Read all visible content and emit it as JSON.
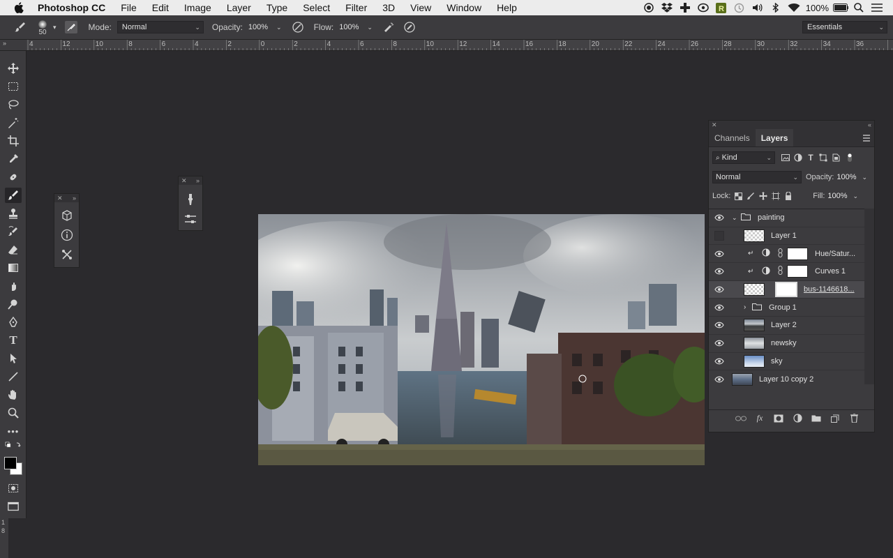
{
  "menubar": {
    "app_name": "Photoshop CC",
    "items": [
      "File",
      "Edit",
      "Image",
      "Layer",
      "Type",
      "Select",
      "Filter",
      "3D",
      "View",
      "Window",
      "Help"
    ],
    "battery": "100%"
  },
  "options": {
    "brush_size": "50",
    "mode_label": "Mode:",
    "mode_value": "Normal",
    "opacity_label": "Opacity:",
    "opacity_value": "100%",
    "flow_label": "Flow:",
    "flow_value": "100%",
    "workspace": "Essentials"
  },
  "ruler": {
    "labels": [
      "4",
      "12",
      "10",
      "8",
      "6",
      "4",
      "2",
      "0",
      "2",
      "4",
      "6",
      "8",
      "10",
      "12",
      "14",
      "16",
      "18",
      "20",
      "22",
      "24",
      "26",
      "28",
      "30",
      "32",
      "34",
      "36"
    ]
  },
  "layers_panel": {
    "tabs": [
      "Channels",
      "Layers"
    ],
    "filter_kind": "Kind",
    "blend_mode": "Normal",
    "opacity_label": "Opacity:",
    "opacity_value": "100%",
    "lock_label": "Lock:",
    "fill_label": "Fill:",
    "fill_value": "100%",
    "layers": [
      {
        "name": "painting",
        "type": "group-open",
        "visible": true
      },
      {
        "name": "Layer 1",
        "type": "pixel-empty",
        "visible": false
      },
      {
        "name": "Hue/Satur...",
        "type": "adjustment",
        "visible": true
      },
      {
        "name": "Curves 1",
        "type": "adjustment",
        "visible": true
      },
      {
        "name": "bus-1146618...",
        "type": "masked",
        "visible": true,
        "selected": true
      },
      {
        "name": "Group 1",
        "type": "group-closed",
        "visible": true
      },
      {
        "name": "Layer 2",
        "type": "photo",
        "visible": true
      },
      {
        "name": "newsky",
        "type": "photo",
        "visible": true
      },
      {
        "name": "sky",
        "type": "photo",
        "visible": true
      },
      {
        "name": "Layer 10 copy 2",
        "type": "photo",
        "visible": true
      }
    ]
  },
  "colors": {
    "ui_bg": "#2b2a2d",
    "panel_bg": "#3c3b3e",
    "menubar_bg": "#ececec",
    "selected_row": "#4a494d"
  }
}
